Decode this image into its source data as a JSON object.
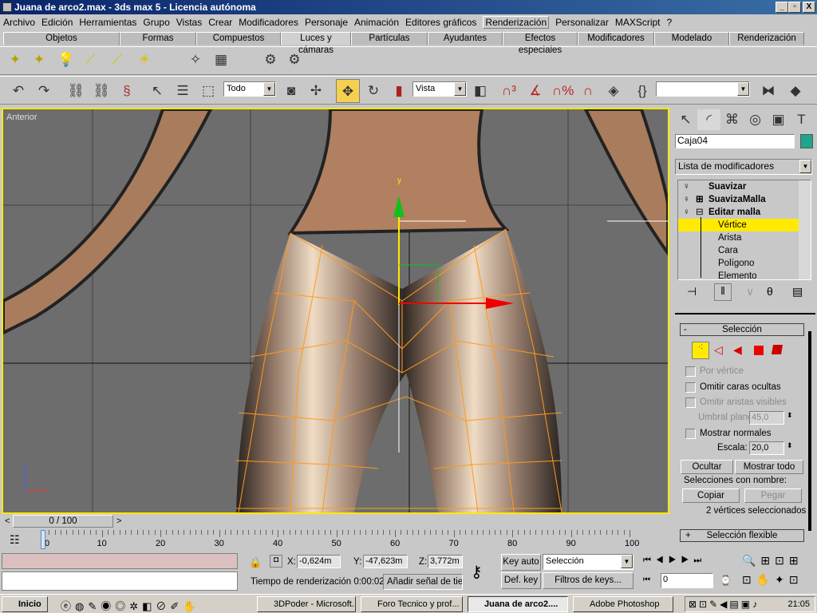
{
  "window": {
    "title": "Juana de arco2.max - 3ds max 5 - Licencia autónoma",
    "controls": [
      "_",
      "▫",
      "X"
    ]
  },
  "menu": [
    "Archivo",
    "Edición",
    "Herramientas",
    "Grupo",
    "Vistas",
    "Crear",
    "Modificadores",
    "Personaje",
    "Animación",
    "Editores gráficos",
    "Renderización",
    "Personalizar",
    "MAXScript",
    "?"
  ],
  "tabs": [
    "Objetos",
    "Formas",
    "Compuestos",
    "Luces y cámaras",
    "Partículas",
    "Ayudantes",
    "Efectos especiales",
    "Modificadores",
    "Modelado",
    "Renderización"
  ],
  "active_tab": "Luces y cámaras",
  "toolbar": {
    "selection_filter": "Todo",
    "reference_coord": "Vista",
    "named_selection": ""
  },
  "viewport": {
    "label": "Anterior",
    "gizmo_y": "y",
    "axis_x": "x",
    "axis_z": "z",
    "highlight_color": "#ffea00",
    "mesh_color": "#ff9a1a"
  },
  "panel": {
    "object_name": "Caja04",
    "object_color": "#1fa58a",
    "modifier_list": "Lista de modificadores",
    "stack": [
      "Suavizar",
      "SuavizaMalla",
      "Editar malla",
      "Vértice",
      "Arista",
      "Cara",
      "Polígono",
      "Elemento"
    ],
    "selected_subobject": "Vértice",
    "rollout_title": "Selección",
    "rollout_minus": "-",
    "por_vertice": "Por vértice",
    "omitir_caras": "Omitir caras ocultas",
    "omitir_aristas": "Omitir aristas visibles",
    "umbral_label": "Umbral plano:",
    "umbral_value": "45,0",
    "mostrar_normales": "Mostrar normales",
    "escala_label": "Escala:",
    "escala_value": "20,0",
    "ocultar": "Ocultar",
    "mostrar_todo": "Mostrar todo",
    "named_sel_label": "Selecciones con nombre:",
    "copiar": "Copiar",
    "pegar": "Pegar",
    "status": "2 vértices seleccionados",
    "flex_plus": "+",
    "flex_title": "Selección flexible"
  },
  "timeline": {
    "frame": "0 / 100",
    "prev": "<",
    "next": ">",
    "ticks": [
      "0",
      "10",
      "20",
      "30",
      "40",
      "50",
      "60",
      "70",
      "80",
      "90",
      "100"
    ],
    "current_frame": 0,
    "total_frames": 100
  },
  "status": {
    "x_label": "X:",
    "x": "-0,624m",
    "y_label": "Y:",
    "y": "-47,623m",
    "z_label": "Z:",
    "z": "3,772m",
    "render_time": "Tiempo de renderización  0:00:02",
    "add_tag": "Añadir señal de tiem",
    "key_auto": "Key auto",
    "def_key": "Def. key",
    "key_mode": "Selección",
    "key_filters": "Filtros de keys...",
    "frame_field": "0"
  },
  "taskbar": {
    "start": "Inicio",
    "items": [
      "3DPoder - Microsoft...",
      "Foro Tecnico y prof...",
      "Juana de arco2....",
      "Adobe Photoshop"
    ],
    "active": "Juana de arco2....",
    "clock": "21:05"
  }
}
